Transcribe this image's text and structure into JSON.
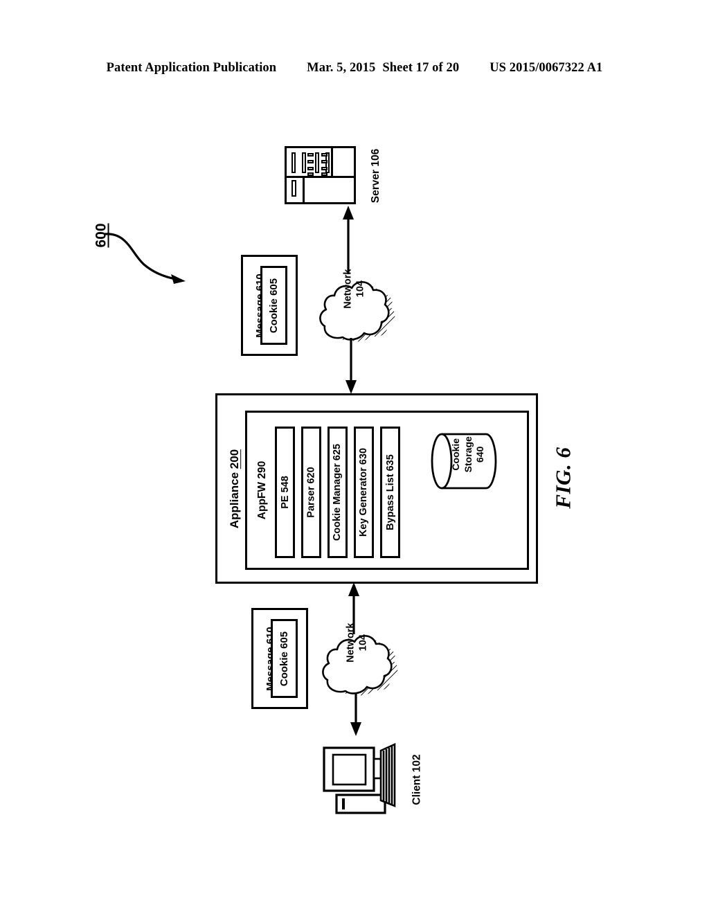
{
  "header": {
    "publication": "Patent Application Publication",
    "date": "Mar. 5, 2015",
    "sheet": "Sheet 17 of 20",
    "patent_number": "US 2015/0067322 A1"
  },
  "figure": {
    "label": "FIG. 6",
    "reference_numeral": "600",
    "server": {
      "label": "Server 106"
    },
    "client": {
      "label": "Client 102"
    },
    "networks": [
      {
        "name": "Network",
        "number": "104"
      },
      {
        "name": "Network",
        "number": "104"
      }
    ],
    "messages": [
      {
        "outer_label": "Message  610",
        "inner_label": "Cookie 605"
      },
      {
        "outer_label": "Message  610",
        "inner_label": "Cookie 605"
      }
    ],
    "appliance": {
      "name": "Appliance ",
      "number": "200",
      "appfw_label": "AppFW 290",
      "components": [
        {
          "label": "PE   548"
        },
        {
          "label": "Parser  620"
        },
        {
          "label": "Cookie Manager  625"
        },
        {
          "label": "Key Generator  630"
        },
        {
          "label": "Bypass List 635"
        }
      ],
      "storage": {
        "line1": "Cookie",
        "line2": "Storage",
        "line3": "640"
      }
    }
  },
  "colors": {
    "ink": "#000000",
    "paper": "#ffffff",
    "shadow_hatch": "#000000"
  }
}
